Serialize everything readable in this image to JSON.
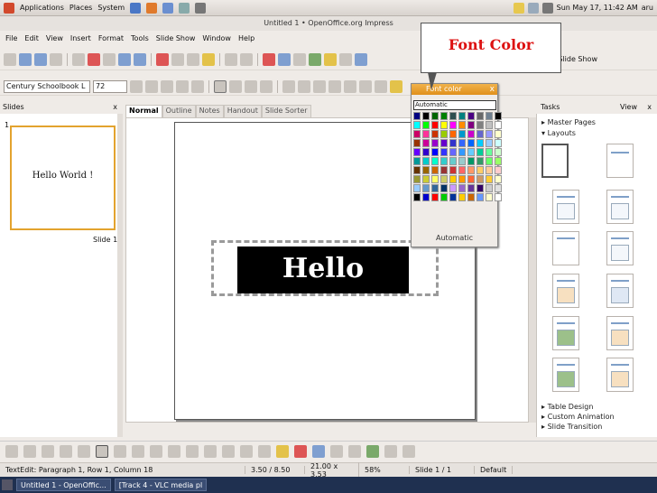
{
  "gnome_panel": {
    "menus": [
      "Applications",
      "Places",
      "System"
    ],
    "clock": "Sun May 17, 11:42 AM",
    "user": "aru"
  },
  "window_title": "Untitled 1 • OpenOffice.org Impress",
  "menu": [
    "File",
    "Edit",
    "View",
    "Insert",
    "Format",
    "Tools",
    "Slide Show",
    "Window",
    "Help"
  ],
  "formatting": {
    "font_name": "Century Schoolbook L",
    "font_size": "72"
  },
  "slide_show_label": "Slide Show",
  "slides_pane": {
    "title": "Slides",
    "close": "x",
    "slide_number": "1",
    "slide_label": "Slide 1",
    "thumb_text": "Hello World !"
  },
  "view_tabs": [
    "Normal",
    "Outline",
    "Notes",
    "Handout",
    "Slide Sorter"
  ],
  "slide_text": "Hello World !",
  "tasks": {
    "title": "Tasks",
    "view": "View",
    "close": "x",
    "master_pages": "Master Pages",
    "layouts": "Layouts",
    "table_design": "Table Design",
    "custom_animation": "Custom Animation",
    "slide_transition": "Slide Transition"
  },
  "font_color_popup": {
    "title": "Font color",
    "close": "x",
    "selected": "Automatic",
    "automatic_button": "Automatic",
    "colors": [
      "#000080",
      "#000000",
      "#006400",
      "#008000",
      "#2f4f4f",
      "#008080",
      "#4b0082",
      "#696969",
      "#708090",
      "#000000",
      "#00ffff",
      "#00ff00",
      "#ff0000",
      "#ffff00",
      "#ff00ff",
      "#ff8c00",
      "#800080",
      "#808080",
      "#c0c0c0",
      "#ffffff",
      "#cc0066",
      "#ff3399",
      "#cc3300",
      "#99cc00",
      "#ff6600",
      "#0099cc",
      "#cc00cc",
      "#6666cc",
      "#9999ff",
      "#ffffcc",
      "#993300",
      "#cc0099",
      "#9900cc",
      "#6600cc",
      "#3333cc",
      "#3366ff",
      "#0066ff",
      "#00ccff",
      "#99ccff",
      "#ccffff",
      "#6600ff",
      "#3300cc",
      "#0000ff",
      "#3333ff",
      "#6666ff",
      "#3399ff",
      "#66ccff",
      "#00cc99",
      "#66ff99",
      "#ccffcc",
      "#009999",
      "#00cccc",
      "#00ffcc",
      "#33cccc",
      "#66cccc",
      "#99cccc",
      "#009966",
      "#339966",
      "#66ff66",
      "#99ff66",
      "#663300",
      "#996600",
      "#cc6600",
      "#993333",
      "#cc3333",
      "#ff6666",
      "#ff9966",
      "#ffcc66",
      "#ffcc99",
      "#ffcccc",
      "#999933",
      "#cccc33",
      "#ffff66",
      "#cccc66",
      "#ffcc00",
      "#ff9900",
      "#ff6633",
      "#cc9966",
      "#ffcc33",
      "#ffffcc",
      "#99ccff",
      "#6699cc",
      "#336699",
      "#003366",
      "#cc99ff",
      "#9966cc",
      "#663399",
      "#330066",
      "#cccccc",
      "#e0e0e0",
      "#000000",
      "#0000cc",
      "#ff0000",
      "#00cc00",
      "#003399",
      "#ffcc00",
      "#cc6600",
      "#6699ff",
      "#ffffcc",
      "#ffffff"
    ]
  },
  "callout": "Font Color",
  "status": {
    "mode": "TextEdit: Paragraph 1, Row 1, Column 18",
    "position": "3.50 / 8.50",
    "size": "21.00 x 3.53",
    "zoom": "58%",
    "slide": "Slide 1 / 1",
    "layout": "Default"
  },
  "taskbar": [
    "Untitled 1 - OpenOffic...",
    "[Track 4 - VLC media pl"
  ]
}
